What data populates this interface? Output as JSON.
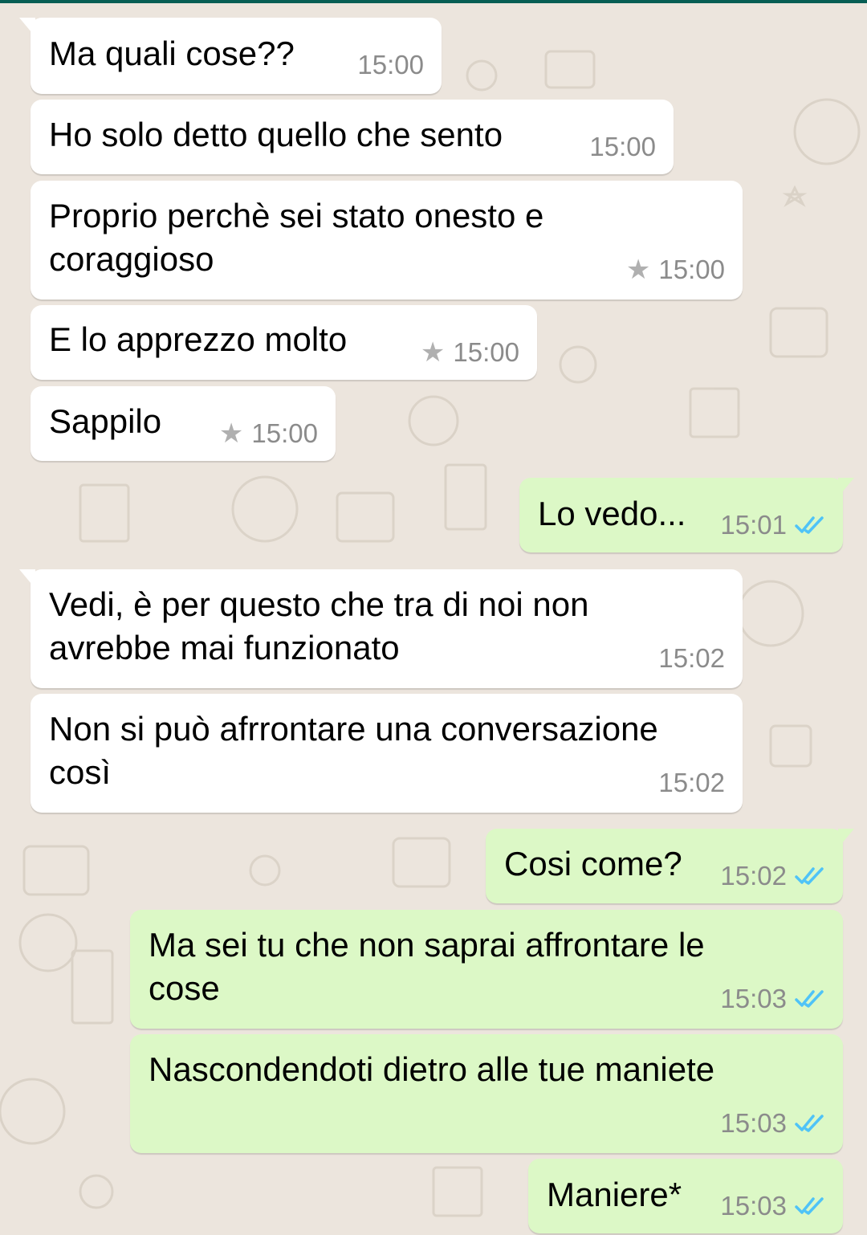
{
  "colors": {
    "header": "#075e54",
    "background": "#ece5dd",
    "incoming_bubble": "#ffffff",
    "outgoing_bubble": "#dcf8c6",
    "read_ticks": "#4fc3f7",
    "timestamp": "#8b8b8b"
  },
  "icons": {
    "star": "starred-message-icon",
    "ticks": "double-check-read-icon"
  },
  "messages": [
    {
      "direction": "in",
      "text": "Ma quali cose??",
      "time": "15:00",
      "starred": false
    },
    {
      "direction": "in",
      "text": "Ho solo detto quello che sento",
      "time": "15:00",
      "starred": false
    },
    {
      "direction": "in",
      "text": "Proprio perchè sei stato onesto e\ncoraggioso",
      "time": "15:00",
      "starred": true
    },
    {
      "direction": "in",
      "text": "E lo apprezzo molto",
      "time": "15:00",
      "starred": true
    },
    {
      "direction": "in",
      "text": "Sappilo",
      "time": "15:00",
      "starred": true
    },
    {
      "direction": "out",
      "text": "Lo vedo...",
      "time": "15:01",
      "read": true
    },
    {
      "direction": "in",
      "text": "Vedi, è per questo che tra di noi non\navrebbe mai funzionato",
      "time": "15:02",
      "starred": false
    },
    {
      "direction": "in",
      "text": "Non si può afrrontare una conversazione\ncosì",
      "time": "15:02",
      "starred": false
    },
    {
      "direction": "out",
      "text": "Cosi come?",
      "time": "15:02",
      "read": true
    },
    {
      "direction": "out",
      "text": "Ma sei tu che non saprai affrontare le\ncose",
      "time": "15:03",
      "read": true
    },
    {
      "direction": "out",
      "text": "Nascondendoti dietro alle tue maniete",
      "time": "15:03",
      "read": true
    },
    {
      "direction": "out",
      "text": "Maniere*",
      "time": "15:03",
      "read": true
    }
  ]
}
